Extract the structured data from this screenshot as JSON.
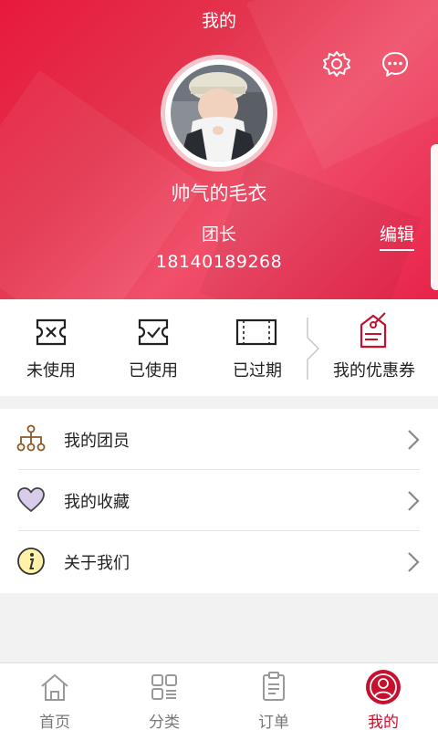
{
  "header": {
    "title": "我的",
    "username": "帅气的毛衣",
    "role": "团长",
    "phone": "18140189268",
    "edit_label": "编辑",
    "icons": [
      "gear-icon",
      "chat-bubble-icon"
    ]
  },
  "coupons": {
    "items": [
      {
        "label": "未使用",
        "icon": "ticket-x-icon"
      },
      {
        "label": "已使用",
        "icon": "ticket-check-icon"
      },
      {
        "label": "已过期",
        "icon": "ticket-expired-icon"
      }
    ],
    "my_coupons_label": "我的优惠券"
  },
  "menu": {
    "items": [
      {
        "label": "我的团员",
        "icon": "team-tree-icon"
      },
      {
        "label": "我的收藏",
        "icon": "heart-icon"
      },
      {
        "label": "关于我们",
        "icon": "info-icon"
      }
    ]
  },
  "nav": {
    "items": [
      {
        "label": "首页",
        "icon": "home-icon"
      },
      {
        "label": "分类",
        "icon": "category-grid-icon"
      },
      {
        "label": "订单",
        "icon": "order-list-icon"
      },
      {
        "label": "我的",
        "icon": "profile-icon"
      }
    ],
    "active_index": 3
  },
  "colors": {
    "brand": "#e8193c",
    "active": "#c8102e"
  }
}
